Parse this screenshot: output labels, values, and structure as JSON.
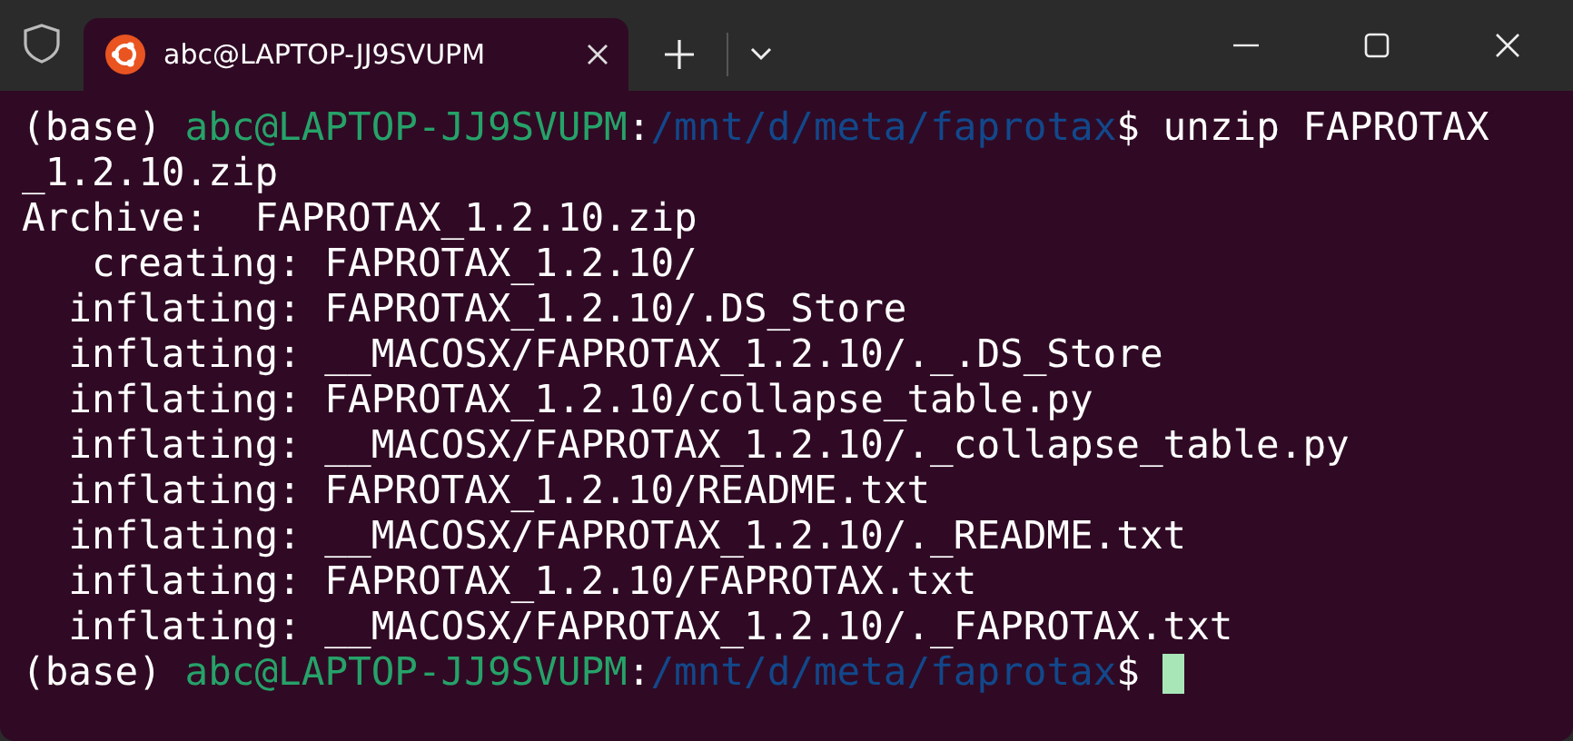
{
  "tab": {
    "title": "abc@LAPTOP-JJ9SVUPM",
    "selected": true
  },
  "lines": [
    [
      {
        "kind": "plain",
        "text": "(base) "
      },
      {
        "kind": "user",
        "text": "abc@LAPTOP-JJ9SVUPM"
      },
      {
        "kind": "plain",
        "text": ":"
      },
      {
        "kind": "path",
        "text": "/mnt/d/meta/faprotax"
      },
      {
        "kind": "plain",
        "text": "$ unzip FAPROTAX"
      }
    ],
    [
      {
        "kind": "plain",
        "text": "_1.2.10.zip"
      }
    ],
    [
      {
        "kind": "plain",
        "text": "Archive:  FAPROTAX_1.2.10.zip"
      }
    ],
    [
      {
        "kind": "plain",
        "text": "   creating: FAPROTAX_1.2.10/"
      }
    ],
    [
      {
        "kind": "plain",
        "text": "  inflating: FAPROTAX_1.2.10/.DS_Store"
      }
    ],
    [
      {
        "kind": "plain",
        "text": "  inflating: __MACOSX/FAPROTAX_1.2.10/._.DS_Store"
      }
    ],
    [
      {
        "kind": "plain",
        "text": "  inflating: FAPROTAX_1.2.10/collapse_table.py"
      }
    ],
    [
      {
        "kind": "plain",
        "text": "  inflating: __MACOSX/FAPROTAX_1.2.10/._collapse_table.py"
      }
    ],
    [
      {
        "kind": "plain",
        "text": "  inflating: FAPROTAX_1.2.10/README.txt"
      }
    ],
    [
      {
        "kind": "plain",
        "text": "  inflating: __MACOSX/FAPROTAX_1.2.10/._README.txt"
      }
    ],
    [
      {
        "kind": "plain",
        "text": "  inflating: FAPROTAX_1.2.10/FAPROTAX.txt"
      }
    ],
    [
      {
        "kind": "plain",
        "text": "  inflating: __MACOSX/FAPROTAX_1.2.10/._FAPROTAX.txt"
      }
    ],
    [
      {
        "kind": "plain",
        "text": "(base) "
      },
      {
        "kind": "user",
        "text": "abc@LAPTOP-JJ9SVUPM"
      },
      {
        "kind": "plain",
        "text": ":"
      },
      {
        "kind": "path",
        "text": "/mnt/d/meta/faprotax"
      },
      {
        "kind": "plain",
        "text": "$ "
      },
      {
        "kind": "cursor"
      }
    ]
  ]
}
